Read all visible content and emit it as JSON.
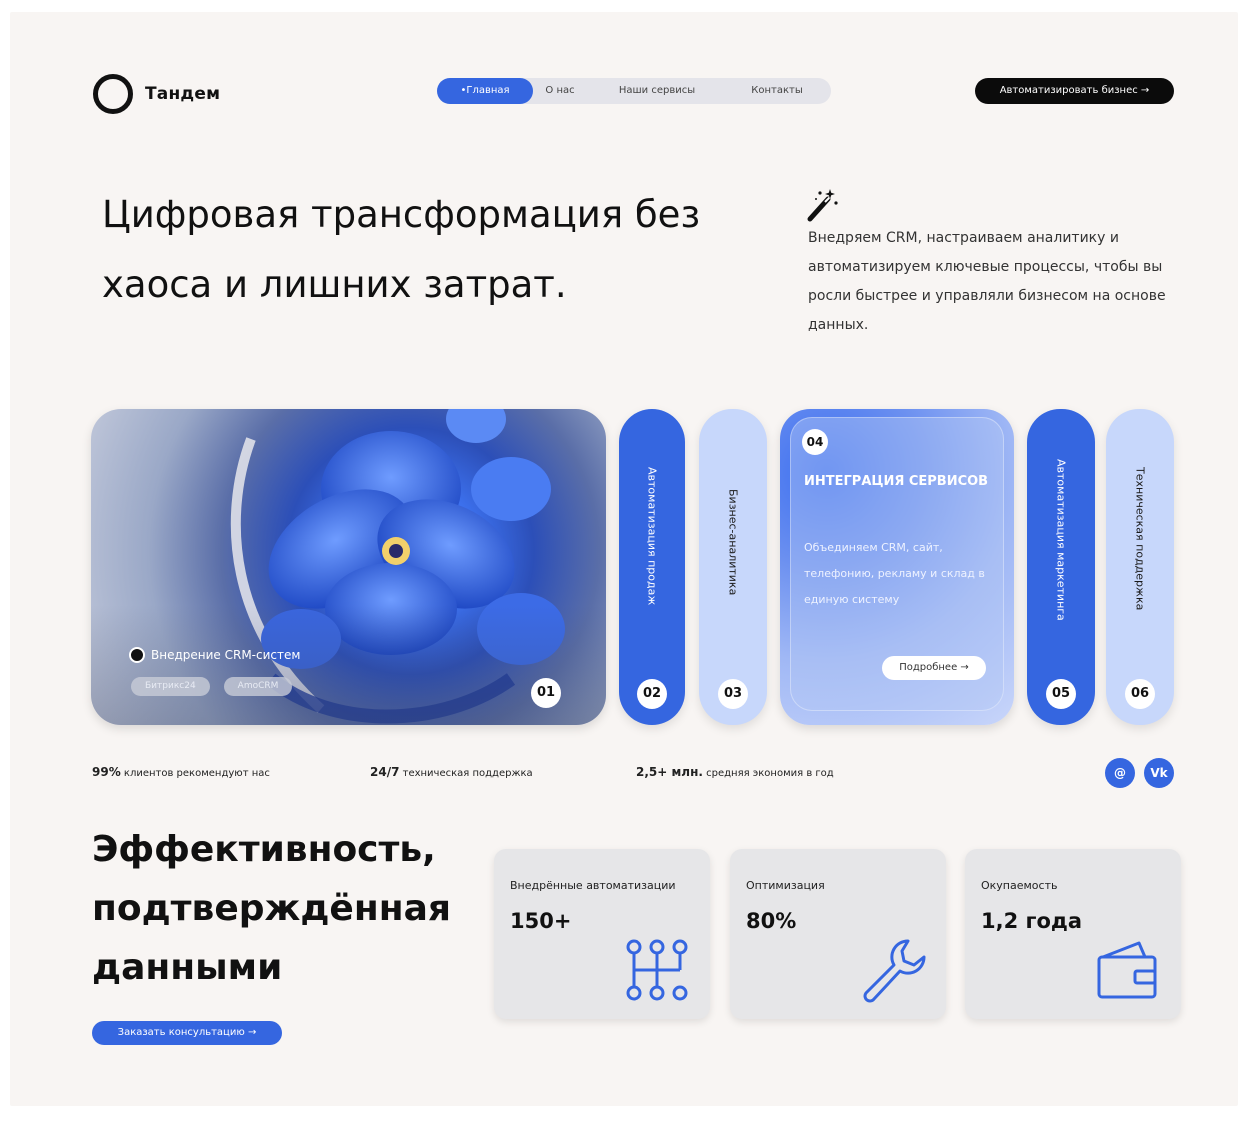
{
  "brand": {
    "name": "Тандем"
  },
  "nav": {
    "items": [
      {
        "label": "•Главная"
      },
      {
        "label": "О нас"
      },
      {
        "label": "Наши сервисы"
      },
      {
        "label": "Контакты"
      }
    ],
    "cta": "Автоматизировать бизнес →"
  },
  "hero": {
    "title": "Цифровая трансформация без хаоса и лишних затрат.",
    "description": "Внедряем CRM, настраиваем аналитику и автоматизируем ключевые процессы, чтобы вы росли быстрее и управляли бизнесом на основе данных."
  },
  "services": {
    "main": {
      "number": "01",
      "label": "Внедрение CRM-систем",
      "tags": [
        "Битрикс24",
        "AmoCRM"
      ]
    },
    "s02": {
      "number": "02",
      "label": "Автоматизация продаж"
    },
    "s03": {
      "number": "03",
      "label": "Бизнес-аналитика"
    },
    "s04": {
      "number": "04",
      "title": "ИНТЕГРАЦИЯ СЕРВИСОВ",
      "text": "Объединяем CRM, сайт, телефонию, рекламу и склад в единую систему",
      "button": "Подробнее →"
    },
    "s05": {
      "number": "05",
      "label": "Автоматизация маркетинга"
    },
    "s06": {
      "number": "06",
      "label": "Техническая поддержка"
    }
  },
  "stats": [
    {
      "value": "99%",
      "text": " клиентов рекомендуют нас"
    },
    {
      "value": "24/7",
      "text": " техническая поддержка"
    },
    {
      "value": "2,5+ млн.",
      "text": " средняя экономия в год"
    }
  ],
  "social": {
    "email": "@",
    "vk": "Vk"
  },
  "efficiency": {
    "title": "Эффективность, подтверждённая данными",
    "button": "Заказать консультацию →",
    "metrics": [
      {
        "label": "Внедрённые автоматизации",
        "value": "150+",
        "icon": "network-icon"
      },
      {
        "label": "Оптимизация",
        "value": "80%",
        "icon": "wrench-icon"
      },
      {
        "label": "Окупаемость",
        "value": "1,2 года",
        "icon": "wallet-icon"
      }
    ]
  },
  "colors": {
    "accent": "#3566e0",
    "accent_light": "#c7d7fb",
    "background": "#f8f5f3",
    "dark": "#0b0b0b"
  }
}
